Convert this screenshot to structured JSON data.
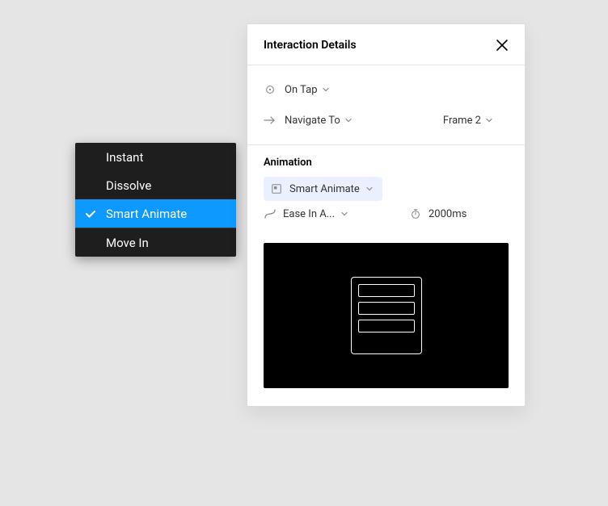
{
  "panel": {
    "title": "Interaction Details",
    "trigger": {
      "label": "On Tap"
    },
    "action": {
      "label": "Navigate To",
      "target": "Frame 2"
    },
    "animation": {
      "section_title": "Animation",
      "type": "Smart Animate",
      "easing": "Ease In A...",
      "duration": "2000ms"
    }
  },
  "dropdown": {
    "items": [
      {
        "label": "Instant",
        "selected": false
      },
      {
        "label": "Dissolve",
        "selected": false
      },
      {
        "label": "Smart Animate",
        "selected": true
      },
      {
        "label": "Move In",
        "selected": false
      }
    ]
  }
}
